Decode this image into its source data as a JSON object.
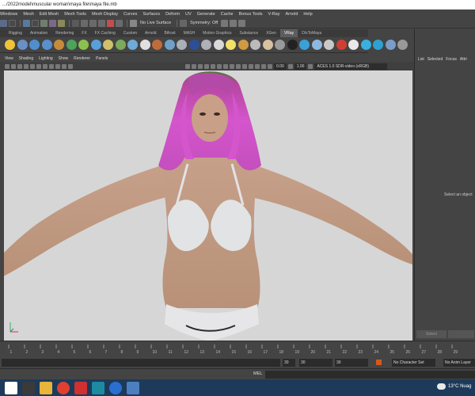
{
  "window": {
    "title": "…/2022model\\muscular woman\\maya file\\maya file.mb"
  },
  "menu": [
    "Windows",
    "Mesh",
    "Edit Mesh",
    "Mesh Tools",
    "Mesh Display",
    "Curves",
    "Surfaces",
    "Deform",
    "UV",
    "Generate",
    "Cache",
    "Bonus Tools",
    "V-Ray",
    "Arnold",
    "Help"
  ],
  "status_line": {
    "live_surface": "No Live Surface",
    "symmetry": "Symmetry: Off"
  },
  "shelf_tabs": [
    {
      "label": "Rigging",
      "active": false
    },
    {
      "label": "Animation",
      "active": false
    },
    {
      "label": "Rendering",
      "active": false
    },
    {
      "label": "FX",
      "active": false
    },
    {
      "label": "FX Caching",
      "active": false
    },
    {
      "label": "Custom",
      "active": false
    },
    {
      "label": "Arnold",
      "active": false
    },
    {
      "label": "Bifrost",
      "active": false
    },
    {
      "label": "MASH",
      "active": false
    },
    {
      "label": "Motion Graphics",
      "active": false
    },
    {
      "label": "Substance",
      "active": false
    },
    {
      "label": "XGen",
      "active": false
    },
    {
      "label": "VRay",
      "active": true
    },
    {
      "label": "DIzToMaya",
      "active": false
    }
  ],
  "shelf_icon_colors": [
    "#f0c23a",
    "#6a8fc8",
    "#4f8fd0",
    "#5a8fcc",
    "#c88a3a",
    "#4ea35a",
    "#8bc04e",
    "#58a0d8",
    "#d0c06a",
    "#7aaa5a",
    "#6faad8",
    "#e0e0e0",
    "#c06b3a",
    "#6fa0c8",
    "#aab0b8",
    "#2d4f9a",
    "#b0b0b8",
    "#d8d8d8",
    "#f2e06a",
    "#d09a40",
    "#bbbbbb",
    "#d8c0a0",
    "#9a9a9a",
    "#222222",
    "#3aa0d8",
    "#8fb8e0",
    "#c8c8c8",
    "#d04030",
    "#e8e8e8",
    "#3ab0e0",
    "#30a0d0",
    "#7a9cc8",
    "#999999"
  ],
  "panel": {
    "menu": [
      "View",
      "Shading",
      "Lighting",
      "Show",
      "Renderer",
      "Panels"
    ],
    "exposure": "0.00",
    "gamma": "1.00",
    "color_transform": "ACES 1.0 SDR-video (sRGB)"
  },
  "right_panel": {
    "tabs": [
      "List",
      "Selected",
      "Focus",
      "Attri"
    ],
    "hint": "Select an object",
    "select_button": "Select"
  },
  "timeline": {
    "ticks": [
      "1",
      "2",
      "3",
      "4",
      "5",
      "6",
      "7",
      "8",
      "9",
      "10",
      "11",
      "12",
      "13",
      "14",
      "15",
      "16",
      "17",
      "18",
      "19",
      "20",
      "21",
      "22",
      "23",
      "24",
      "25",
      "26",
      "27",
      "28",
      "29"
    ],
    "range_start": "30",
    "range_end": "30",
    "anim_end": "30",
    "character_set": "No Character Set",
    "anim_layer": "No Anim Layer"
  },
  "command_line": {
    "label": "MEL"
  },
  "taskbar": {
    "weather": "13°C  Nuag",
    "app_colors": [
      "#ffffff",
      "#3a3a3a",
      "#e8b43a",
      "#e04030",
      "#d03030",
      "#1e8aa0",
      "#2a6fd0",
      "#4c7fbf"
    ]
  },
  "colors": {
    "accent_active_tab": "#5d5d5d",
    "viewport_bg": "#d6d6d6",
    "hair": "#d45bd0",
    "skin": "#c49a82",
    "bra": "#e0e1e3"
  }
}
